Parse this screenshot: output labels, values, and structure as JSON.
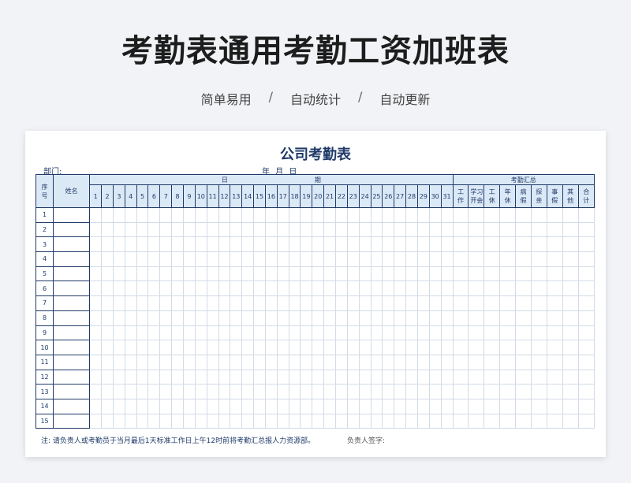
{
  "hero": {
    "title": "考勤表通用考勤工资加班表",
    "tags": [
      "简单易用",
      "自动统计",
      "自动更新"
    ],
    "separator": "/"
  },
  "sheet": {
    "title": "公司考勤表",
    "dept_label": "部门:",
    "date_label": "年 月 日",
    "headers": {
      "index": "序号",
      "name": "姓名",
      "date_group_left": "日",
      "date_group_right": "期",
      "summary_group": "考勤汇总",
      "days": [
        "1",
        "2",
        "3",
        "4",
        "5",
        "6",
        "7",
        "8",
        "9",
        "10",
        "11",
        "12",
        "13",
        "14",
        "15",
        "16",
        "17",
        "18",
        "19",
        "20",
        "21",
        "22",
        "23",
        "24",
        "25",
        "26",
        "27",
        "28",
        "29",
        "30",
        "31"
      ],
      "summary": [
        "工作",
        "学习开会",
        "工休",
        "年休",
        "病假",
        "探亲",
        "事假",
        "其他",
        "合计"
      ]
    },
    "rows": [
      "1",
      "2",
      "3",
      "4",
      "5",
      "6",
      "7",
      "8",
      "9",
      "10",
      "11",
      "12",
      "13",
      "14",
      "15"
    ],
    "note": "注:  请负责人或考勤员于当月最后1天标准工作日上午12时前将考勤汇总报人力资源部。",
    "signature_label": "负责人签字:"
  },
  "colors": {
    "accent": "#1f3a68",
    "header_fill": "#dbe8f6",
    "grid": "#d3dbe6"
  }
}
